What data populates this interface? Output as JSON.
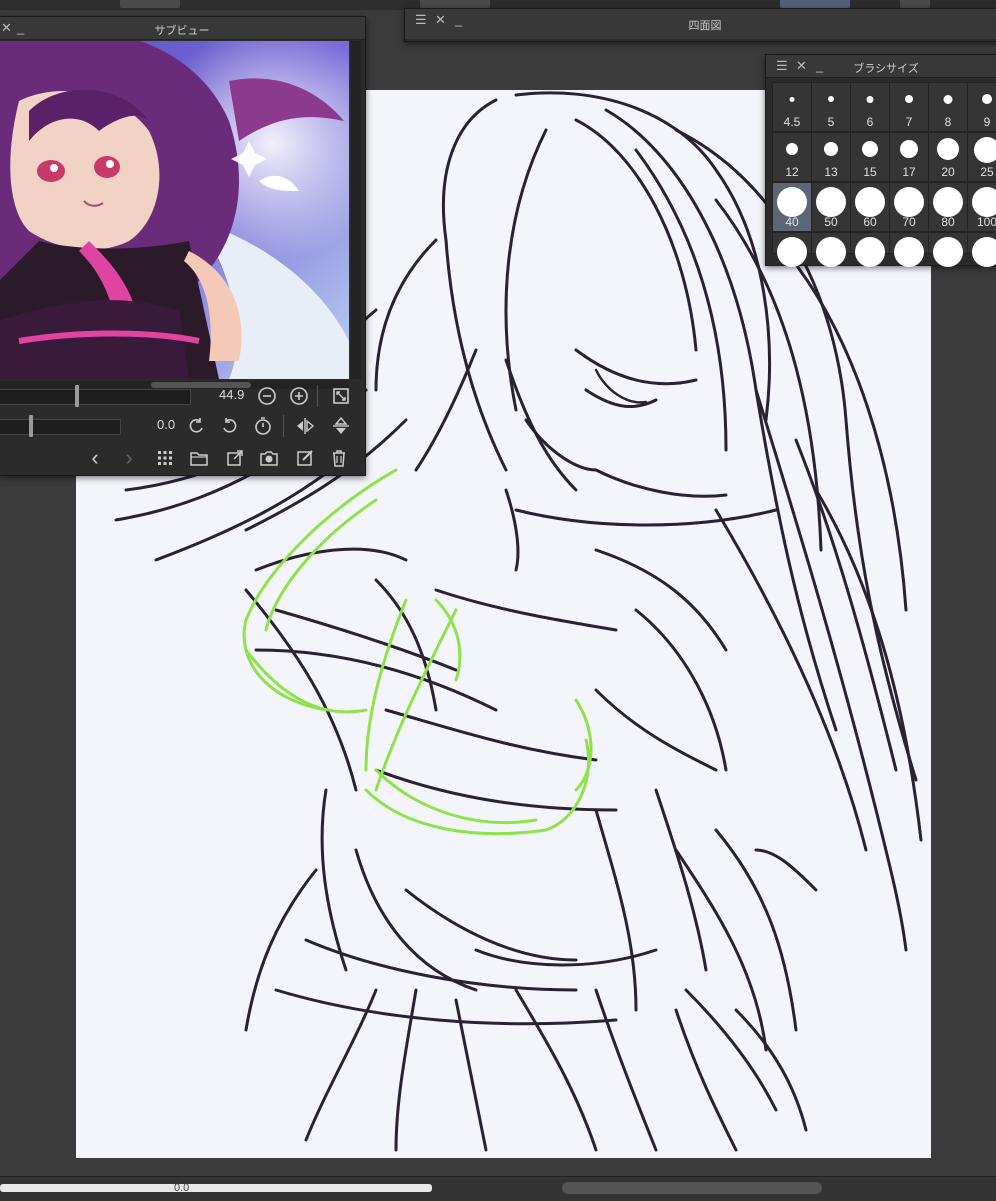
{
  "four_view": {
    "title": "四面図"
  },
  "sub_view": {
    "title": "サブビュー",
    "zoom_value": "44.9",
    "zoom_level": 0.4,
    "rotation_value": "0.0",
    "rotation_level": 0.25
  },
  "brush_size": {
    "title": "ブラシサイズ",
    "rows": [
      [
        "4.5",
        "5",
        "6",
        "7",
        "8",
        "9"
      ],
      [
        "12",
        "13",
        "15",
        "17",
        "20",
        "25"
      ],
      [
        "40",
        "50",
        "60",
        "70",
        "80",
        "100"
      ],
      [
        "",
        "",
        "",
        "",
        "",
        ""
      ]
    ],
    "selected": "40"
  },
  "bottom_bar": {
    "value": "0.0"
  },
  "colors": {
    "canvas": "#f3f5fa",
    "line_art": "#2a2233",
    "highlight_lines": "#8fe34a",
    "panel_bg": "#2b2b2b",
    "selected_cell": "#5e6575"
  },
  "icons": [
    "menu-icon",
    "close-icon",
    "minimize-icon",
    "zoom-out-icon",
    "zoom-in-icon",
    "fit-icon",
    "rotate-left-icon",
    "rotate-right-icon",
    "reset-rotation-icon",
    "flip-horizontal-icon",
    "flip-vertical-icon",
    "prev-icon",
    "next-icon",
    "grid-icon",
    "open-folder-icon",
    "import-icon",
    "camera-icon",
    "edit-icon",
    "trash-icon"
  ]
}
